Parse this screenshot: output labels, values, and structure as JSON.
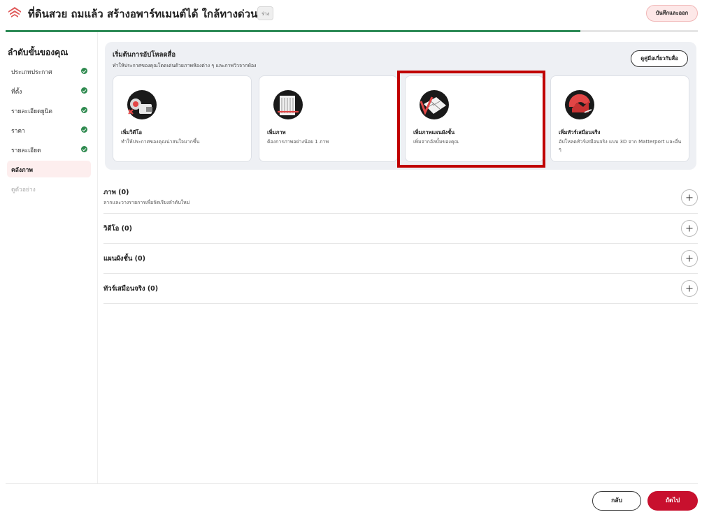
{
  "header": {
    "title": "ที่ดินสวย ถมแล้ว สร้างอพาร์ทเมนต์ได้ ใกล้ทางด่วน",
    "badge": "ร่าง",
    "save_exit_label": "บันทึกและออก"
  },
  "progress": {
    "fraction": 0.83,
    "color": "#2e8b57"
  },
  "sidebar": {
    "heading": "ลำดับขั้นของคุณ",
    "items": [
      {
        "label": "ประเภทประกาศ",
        "state": "done"
      },
      {
        "label": "ที่ตั้ง",
        "state": "done"
      },
      {
        "label": "รายละเอียดยูนิต",
        "state": "done"
      },
      {
        "label": "ราคา",
        "state": "done"
      },
      {
        "label": "รายละเอียด",
        "state": "done"
      },
      {
        "label": "คลังภาพ",
        "state": "active"
      },
      {
        "label": "ดูตัวอย่าง",
        "state": "disabled"
      }
    ]
  },
  "upload_panel": {
    "title": "เริ่มต้นการอัปโหลดสื่อ",
    "subtitle": "ทำให้ประกาศของคุณโดดเด่นด้วยภาพห้องต่าง ๆ และภาพวิวจากห้อง",
    "guide_button": "ดูคู่มือเกี่ยวกับสื่อ",
    "cards": [
      {
        "title": "เพิ่มวิดีโอ",
        "description": "ทำให้ประกาศของคุณน่าสนใจมากขึ้น",
        "icon": "video-camera-icon"
      },
      {
        "title": "เพิ่มภาพ",
        "description": "ต้องการภาพอย่างน้อย 1 ภาพ",
        "icon": "photo-icon"
      },
      {
        "title": "เพิ่มภาพแผนผังชั้น",
        "description": "เพิ่มจากอัลบั้มของคุณ",
        "icon": "floor-plan-icon"
      },
      {
        "title": "เพิ่มทัวร์เสมือนจริง",
        "description": "อัปโหลดทัวร์เสมือนจริง แบบ 3D จาก Matterport และอื่น ๆ",
        "icon": "virtual-tour-icon"
      }
    ]
  },
  "sections": [
    {
      "title": "ภาพ (0)",
      "subtitle": "ลากและวางรายการเพื่อจัดเรียงลำดับใหม่"
    },
    {
      "title": "วิดีโอ (0)"
    },
    {
      "title": "แผนผังชั้น (0)"
    },
    {
      "title": "ทัวร์เสมือนจริง (0)"
    }
  ],
  "footer": {
    "back_label": "กลับ",
    "next_label": "ถัดไป"
  },
  "colors": {
    "brand": "#c8102e",
    "success": "#2f8a4f",
    "highlight": "#c00000"
  }
}
